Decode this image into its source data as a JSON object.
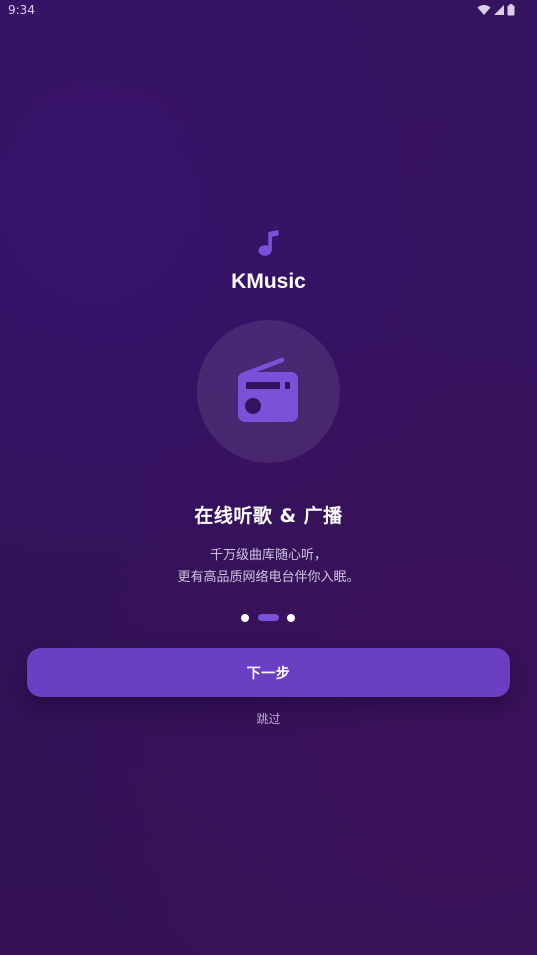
{
  "status_bar": {
    "time": "9:34",
    "icons": [
      "wifi-icon",
      "cell-signal-icon",
      "battery-icon"
    ]
  },
  "brand": {
    "icon": "music-note-icon",
    "app_name": "KMusic"
  },
  "illustration": {
    "icon": "radio-icon"
  },
  "headline": "在线听歌 & 广播",
  "description": {
    "line1": "千万级曲库随心听，",
    "line2": "更有高品质网络电台伴你入眠。"
  },
  "pager": {
    "total": 3,
    "current": 2
  },
  "actions": {
    "next_label": "下一步",
    "skip_label": "跳过"
  },
  "colors": {
    "accent": "#6a3fc2",
    "icon_purple": "#7a52d9",
    "background": "#34125e"
  }
}
